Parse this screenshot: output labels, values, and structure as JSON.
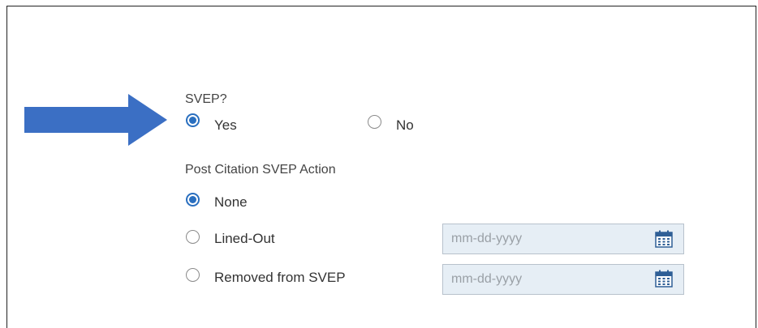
{
  "svep": {
    "label": "SVEP?",
    "yes_label": "Yes",
    "no_label": "No",
    "selected": "Yes"
  },
  "post_citation": {
    "label": "Post Citation SVEP Action",
    "options": [
      {
        "label": "None",
        "selected": true
      },
      {
        "label": "Lined-Out",
        "selected": false,
        "date_placeholder": "mm-dd-yyyy"
      },
      {
        "label": "Removed from SVEP",
        "selected": false,
        "date_placeholder": "mm-dd-yyyy"
      }
    ]
  },
  "colors": {
    "accent": "#2a6fbf",
    "arrow": "#3b6fc4",
    "date_field_bg": "#e6eef5"
  },
  "icons": {
    "arrow": "right-arrow-icon",
    "calendar": "calendar-icon"
  }
}
